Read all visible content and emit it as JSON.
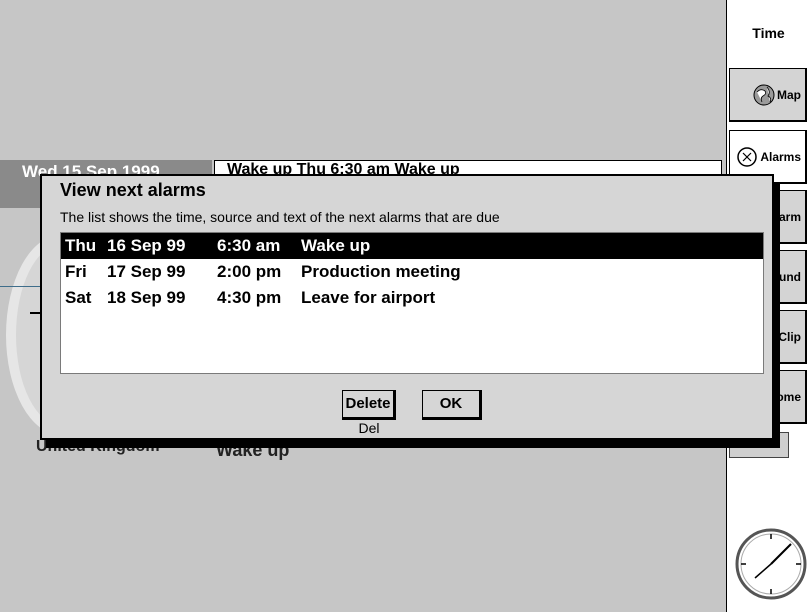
{
  "background": {
    "date_fragment": "Wed 15 Sep 1999",
    "alarm_fragment": "Wake up  Thu 6:30 am  Wake up",
    "location_fragment": "United Kingdom",
    "next_alarm_text": "Wake up"
  },
  "toolbar": {
    "title": "Time",
    "buttons": [
      {
        "label": "Map",
        "icon": "globe-icon"
      },
      {
        "label": "Alarms",
        "icon": "clock-icon"
      },
      {
        "label": "New alarm",
        "icon": ""
      },
      {
        "label": "Sound",
        "icon": ""
      },
      {
        "label": "Clip",
        "icon": ""
      },
      {
        "label": "Home",
        "icon": ""
      }
    ],
    "check_glyph": "✓"
  },
  "dialog": {
    "title": "View next alarms",
    "description": "The list shows the time, source and text of the next alarms that are due",
    "alarms": [
      {
        "day": "Thu",
        "date": "16 Sep 99",
        "time": "6:30 am",
        "text": "Wake up"
      },
      {
        "day": "Fri",
        "date": "17 Sep 99",
        "time": "2:00 pm",
        "text": "Production meeting"
      },
      {
        "day": "Sat",
        "date": "18 Sep 99",
        "time": "4:30 pm",
        "text": "Leave for airport"
      }
    ],
    "delete_label": "Delete",
    "delete_shortcut": "Del",
    "ok_label": "OK"
  }
}
